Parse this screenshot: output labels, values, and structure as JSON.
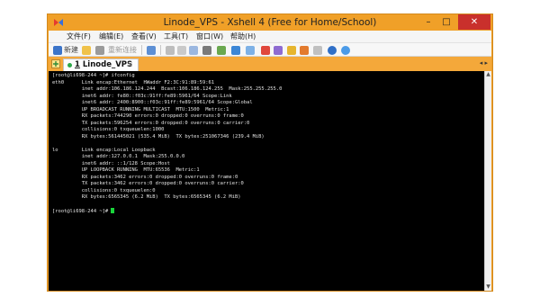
{
  "window": {
    "title": "Linode_VPS - Xshell 4 (Free for Home/School)",
    "minimize_glyph": "–",
    "maximize_glyph": "□",
    "close_glyph": "✕",
    "accent": "#f0a028",
    "close_color": "#c9302c"
  },
  "menu": [
    "文件(F)",
    "编辑(E)",
    "查看(V)",
    "工具(T)",
    "窗口(W)",
    "帮助(H)"
  ],
  "toolbar": {
    "new_label": "新建",
    "reconnect_label": "重新连接"
  },
  "tabs": [
    {
      "number": "1",
      "label": "Linode_VPS",
      "close_glyph": "×"
    }
  ],
  "terminal": {
    "lines": [
      "[root@li698-244 ~]# ifconfig",
      "eth0      Link encap:Ethernet  HWaddr F2:3C:91:89:59:61",
      "          inet addr:106.186.124.244  Bcast:106.186.124.255  Mask:255.255.255.0",
      "          inet6 addr: fe80::f03c:91ff:fe89:5961/64 Scope:Link",
      "          inet6 addr: 2400:8900::f03c:91ff:fe89:5961/64 Scope:Global",
      "          UP BROADCAST RUNNING MULTICAST  MTU:1500  Metric:1",
      "          RX packets:744290 errors:0 dropped:0 overruns:0 frame:0",
      "          TX packets:596254 errors:0 dropped:0 overruns:0 carrier:0",
      "          collisions:0 txqueuelen:1000",
      "          RX bytes:561445021 (535.4 MiB)  TX bytes:251067346 (239.4 MiB)",
      "",
      "lo        Link encap:Local Loopback",
      "          inet addr:127.0.0.1  Mask:255.0.0.0",
      "          inet6 addr: ::1/128 Scope:Host",
      "          UP LOOPBACK RUNNING  MTU:65536  Metric:1",
      "          RX packets:3462 errors:0 dropped:0 overruns:0 frame:0",
      "          TX packets:3462 errors:0 dropped:0 overruns:0 carrier:0",
      "          collisions:0 txqueuelen:0",
      "          RX bytes:6565345 (6.2 MiB)  TX bytes:6565345 (6.2 MiB)",
      ""
    ],
    "prompt": "[root@li698-244 ~]# ",
    "background": "#000000",
    "text_color": "#e4e4e4",
    "cursor_color": "#19d43a"
  }
}
